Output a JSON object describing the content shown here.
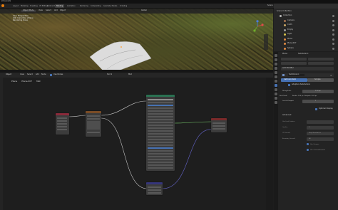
{
  "window": {
    "title": "[Unsaved]"
  },
  "topbar": {
    "tabs": [
      "Layout",
      "Modeling",
      "Sculpting",
      "UV Editing",
      "Texture Paint",
      "Shading",
      "Animation",
      "Rendering",
      "Compositing",
      "Geometry Nodes",
      "Scripting"
    ],
    "active_tab": "Shading",
    "scene": "Scene",
    "view_layer": "ViewLayer"
  },
  "viewport": {
    "mode": "Object Mode",
    "menus": [
      "View",
      "Select",
      "Add",
      "Object"
    ],
    "shading": "Global",
    "info": [
      "User Perspective",
      "(92) Collection | Plane",
      "Rendering Done"
    ]
  },
  "node_editor": {
    "editor_type": "Object",
    "menus": [
      "View",
      "Select",
      "Add",
      "Node"
    ],
    "use_nodes_label": "Use Nodes",
    "slot": "Slot 1",
    "material": "Mat",
    "breadcrumb": [
      "Plane",
      "Plane.007",
      "Mat"
    ]
  },
  "outliner": {
    "title": "Scene Collection",
    "items": [
      "Collection",
      "Camera",
      "Cloth",
      "Empty",
      "Light",
      "Plane",
      "Plane.007",
      "Sphere"
    ]
  },
  "properties": {
    "object": "Plane",
    "modifier_header": "Subdivision",
    "add_modifier": "Add Modifier",
    "modifier_name": "Subdivision",
    "mode_buttons": [
      "Catmull-Clark",
      "Simple"
    ],
    "optimal_display_label": "Adaptive Subdivision",
    "fields": [
      {
        "label": "Dicing Scale",
        "value": "1.00 px"
      },
      {
        "label": "Final Scale",
        "value": "Render 1.00 px, Viewport: 8.00 px"
      },
      {
        "label": "Levels Viewport",
        "value": "1"
      }
    ],
    "optimal_display": "Optimal Display",
    "advanced": "Advanced",
    "advanced_fields": [
      {
        "label": "Use Limit Surface",
        "value": ""
      },
      {
        "label": "Quality",
        "value": "3"
      },
      {
        "label": "UV Smooth",
        "value": "Keep Boundaries"
      },
      {
        "label": "Boundary Smooth",
        "value": "All"
      },
      {
        "label": "",
        "value": "Use Creases"
      },
      {
        "label": "",
        "value": "Use Custom Normals"
      }
    ]
  },
  "colors": {
    "accent": "#4772b3",
    "header_bg": "#232323",
    "panel_bg": "#262626",
    "node_body": "#3c3c3c",
    "bsdf_header": "#2a7252",
    "texture_header": "#7a4c26",
    "output_header": "#7a2a2a",
    "vector_header": "#35357a"
  }
}
